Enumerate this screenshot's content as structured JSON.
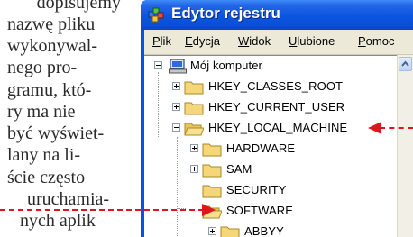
{
  "article": {
    "lines": [
      "dopisujemy",
      "nazwę pliku",
      "wykonywal-",
      "nego pro-",
      "gramu, któ-",
      "ry ma nie",
      "być wyświet-",
      "lany na li-",
      "ście często",
      "uruchamia-",
      "nych aplik"
    ]
  },
  "window": {
    "title": "Edytor rejestru",
    "menu": [
      {
        "label": "Plik",
        "accel": "P",
        "rest": "lik"
      },
      {
        "label": "Edycja",
        "accel": "E",
        "rest": "dycja"
      },
      {
        "label": "Widok",
        "accel": "W",
        "rest": "idok"
      },
      {
        "label": "Ulubione",
        "accel": "U",
        "rest": "lubione"
      },
      {
        "label": "Pomoc",
        "accel": "P",
        "rest": "omoc"
      }
    ],
    "tree": {
      "root": "Mój komputer",
      "hkcr": "HKEY_CLASSES_ROOT",
      "hkcu": "HKEY_CURRENT_USER",
      "hklm": "HKEY_LOCAL_MACHINE",
      "hardware": "HARDWARE",
      "sam": "SAM",
      "security": "SECURITY",
      "software": "SOFTWARE",
      "abbyy": "ABBYY"
    }
  },
  "colors": {
    "titlebar": "#0a55e0",
    "menubar": "#ece9d8",
    "folder": "#f5d779",
    "arrow": "#e0151c"
  }
}
